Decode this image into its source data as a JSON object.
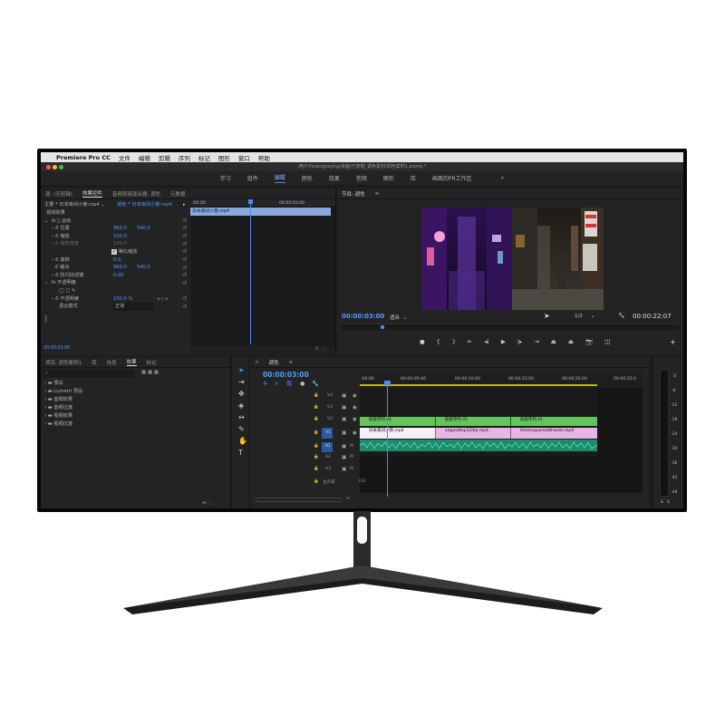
{
  "menubar": {
    "apple": "",
    "app": "Premiere Pro CC",
    "items": [
      "文件",
      "编辑",
      "剪辑",
      "序列",
      "标记",
      "图形",
      "窗口",
      "帮助"
    ]
  },
  "title": "/用户/huangjiaying/桌面/已复制_调色素材/调色案例1.prproj *",
  "workspaces": [
    "学习",
    "组件",
    "编辑",
    "颜色",
    "效果",
    "音频",
    "图形",
    "库",
    "画面的PR工作区"
  ],
  "workspace_active": "编辑",
  "workspace_more": "»",
  "effect_controls": {
    "tabs": [
      "源: (无剪辑)",
      "效果控件",
      "音频剪辑混合器: 调色",
      "元数据"
    ],
    "active_tab": "效果控件",
    "master": "主要 * 日本夜间小巷.mp4",
    "sequence_clip": "调色 * 日本夜间小巷.mp4",
    "ruler_start": ":00:00",
    "ruler_mid": "00:00:03:00",
    "clip_name": "日本夜间小巷.mp4",
    "video_effects": "视频效果",
    "motion": "运动",
    "position": "位置",
    "pos_x": "960.0",
    "pos_y": "540.0",
    "scale": "缩放",
    "scale_val": "100.0",
    "scale_width": "缩放宽度",
    "scale_width_val": "100.0",
    "uniform_scale": "等比缩放",
    "rotation": "旋转",
    "rotation_val": "0.0",
    "anchor": "锚点",
    "anchor_x": "960.0",
    "anchor_y": "540.0",
    "antiflicker": "防闪烁滤镜",
    "antiflicker_val": "0.00",
    "opacity": "不透明度",
    "opacity_label": "不透明度",
    "opacity_val": "100.0 %",
    "blend_mode": "混合模式",
    "blend_val": "正常",
    "timecode": "00:00:03:00"
  },
  "program": {
    "title": "节目: 调色",
    "timecode": "00:00:03:00",
    "fit": "适合",
    "resolution": "1/2",
    "duration": "00:00:22:07"
  },
  "project": {
    "tabs": [
      "项目: 调色案例1",
      "库",
      "信息",
      "效果",
      "标记"
    ],
    "active_tab": "效果",
    "items": [
      "预设",
      "Lumetri 预设",
      "音频效果",
      "音频过渡",
      "视频效果",
      "视频过渡"
    ]
  },
  "timeline": {
    "tab": "调色",
    "timecode": "00:00:03:00",
    "ruler": [
      ":00:00",
      "00:00:05:00",
      "00:00:10:00",
      "00:00:15:00",
      "00:00:20:00",
      "00:00:25:0"
    ],
    "video_tracks": [
      "V4",
      "V3",
      "V2",
      "V1"
    ],
    "audio_tracks": [
      "A1",
      "A2",
      "A3"
    ],
    "master": "主声道",
    "master_val": "0.0",
    "v2_clips": [
      "嵌套序列 01",
      "嵌套序列 01",
      "嵌套序列 01"
    ],
    "v1_clips": [
      "日本夜间小巷.mp4",
      "vegasdtop12dlp.mp4",
      "timessquareatthwide.mp4"
    ]
  },
  "meter": {
    "labels": [
      "0",
      "-6",
      "-12",
      "-18",
      "-24",
      "-30",
      "-36",
      "-42",
      "-48",
      "dB"
    ],
    "solo": "S"
  }
}
